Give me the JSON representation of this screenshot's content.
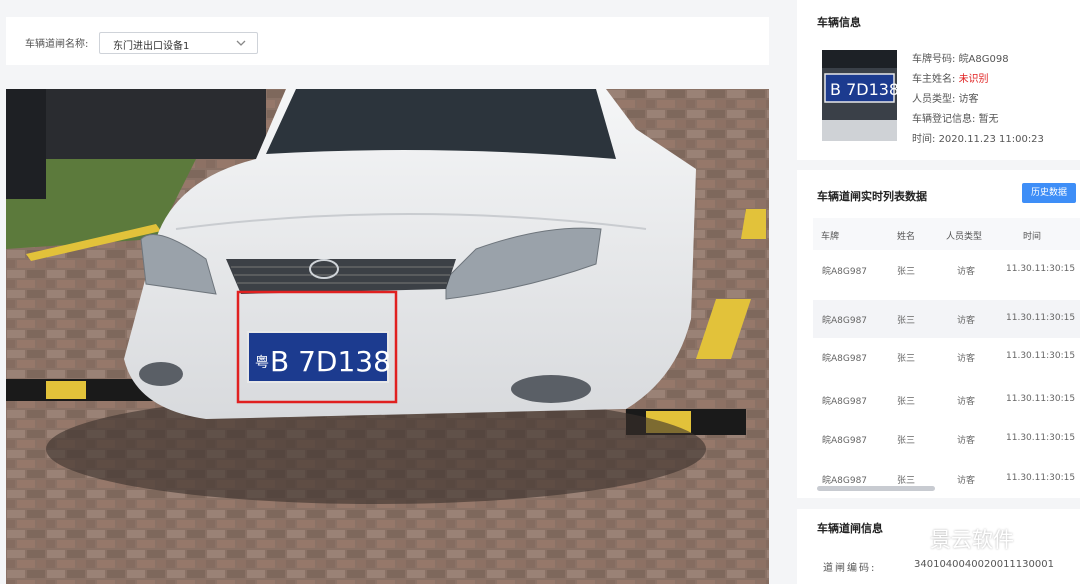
{
  "filter": {
    "label": "车辆道闸名称:",
    "selected": "东门进出口设备1"
  },
  "camera": {
    "plate_text": "粤B 7D138",
    "plate_prefix": "粤",
    "plate_main": "B 7D138",
    "highlight_color": "#e02020"
  },
  "vehicle_info": {
    "title": "车辆信息",
    "thumb_plate": "B 7D138",
    "fields": [
      {
        "label": "车牌号码:",
        "value": "皖A8G098",
        "alert": false
      },
      {
        "label": "车主姓名:",
        "value": "未识别",
        "alert": true
      },
      {
        "label": "人员类型:",
        "value": "访客",
        "alert": false
      },
      {
        "label": "车辆登记信息:",
        "value": "暂无",
        "alert": false
      },
      {
        "label": "时间:",
        "value": "2020.11.23 11:00:23",
        "alert": false
      }
    ]
  },
  "realtime": {
    "title": "车辆道闸实时列表数据",
    "history_button": "历史数据",
    "columns": [
      "车牌",
      "姓名",
      "人员类型",
      "时间"
    ],
    "rows": [
      [
        "皖A8G987",
        "张三",
        "访客",
        "11.30.11:30:15"
      ],
      [
        "皖A8G987",
        "张三",
        "访客",
        "11.30.11:30:15"
      ],
      [
        "皖A8G987",
        "张三",
        "访客",
        "11.30.11:30:15"
      ],
      [
        "皖A8G987",
        "张三",
        "访客",
        "11.30.11:30:15"
      ],
      [
        "皖A8G987",
        "张三",
        "访客",
        "11.30.11:30:15"
      ],
      [
        "皖A8G987",
        "张三",
        "访客",
        "11.30.11:30:15"
      ]
    ]
  },
  "gate_info": {
    "title": "车辆道闸信息",
    "code_label": "道闸编码:",
    "code_value": "3401040040020011130001"
  },
  "watermark": {
    "text": "景云软件"
  },
  "colors": {
    "accent": "#3e8ef7",
    "alert": "#e02020"
  }
}
